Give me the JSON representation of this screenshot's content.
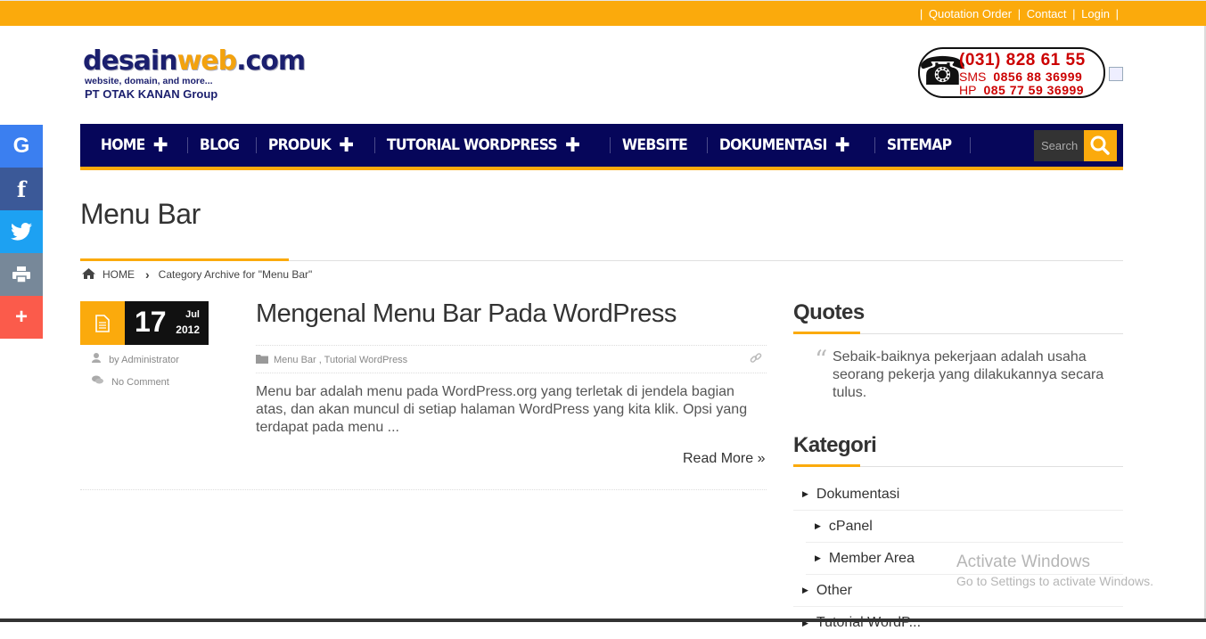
{
  "topbar": {
    "links": [
      "Quotation Order",
      "Contact",
      "Login"
    ],
    "separator": "|"
  },
  "logo": {
    "main_a": "desain",
    "main_b": "web",
    "main_c": ".com",
    "tagline": "website, domain, and more...",
    "group": "PT OTAK KANAN Group"
  },
  "phone": {
    "line1": "(031)  828 61 55",
    "sms_label": "SMS",
    "sms_number": "0856 88 36999",
    "hp_label": "HP",
    "hp_number": "085 77 59 36999"
  },
  "nav": {
    "items": [
      "HOME",
      "BLOG",
      "PRODUK",
      "TUTORIAL WORDPRESS",
      "WEBSITE",
      "DOKUMENTASI",
      "SITEMAP"
    ],
    "plus": "✚",
    "search_placeholder": "Search"
  },
  "page": {
    "title": "Menu Bar"
  },
  "breadcrumb": {
    "home": "HOME",
    "current": "Category Archive for \"Menu Bar\""
  },
  "share": {
    "colors": {
      "google": "#3b7ff0",
      "facebook": "#3b5998",
      "twitter": "#1da1f2",
      "print": "#778899",
      "more": "#fb5b4b"
    }
  },
  "post": {
    "day": "17",
    "month": "Jul",
    "year": "2012",
    "author": "by Administrator",
    "comments": "No Comment",
    "title": "Mengenal Menu Bar Pada WordPress",
    "categories": "Menu Bar , Tutorial WordPress",
    "excerpt": "Menu bar adalah menu pada WordPress.org yang terletak di jendela bagian atas, dan akan muncul di setiap halaman WordPress yang kita klik. Opsi yang terdapat pada menu ...",
    "read_more": "Read More »"
  },
  "sidebar": {
    "quotes_title": "Quotes",
    "quote_text": "Sebaik-baiknya pekerjaan adalah usaha seorang pekerja yang dilakukannya secara tulus.",
    "kategori_title": "Kategori",
    "categories": [
      "Dokumentasi",
      "cPanel",
      "Member Area",
      "Other",
      "Tutorial WordP..."
    ]
  },
  "watermark": {
    "line1": "Activate Windows",
    "line2": "Go to Settings to activate Windows."
  },
  "colors": {
    "accent": "#fbaa0c",
    "navy": "#06065a"
  }
}
